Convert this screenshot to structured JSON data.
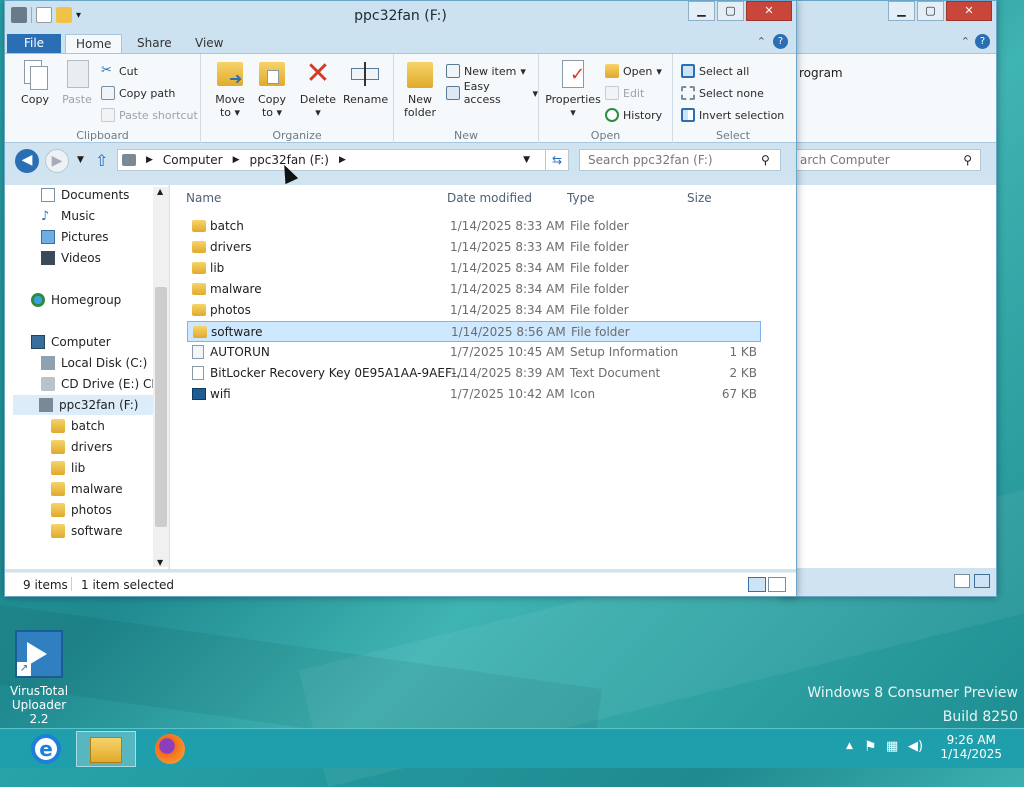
{
  "back_window": {
    "ribbon_partial": "rogram",
    "search_placeholder": "arch Computer"
  },
  "window": {
    "title": "ppc32fan (F:)",
    "tabs": [
      "File",
      "Home",
      "Share",
      "View"
    ],
    "ribbon": {
      "clipboard": {
        "label": "Clipboard",
        "copy": "Copy",
        "paste": "Paste",
        "cut": "Cut",
        "copy_path": "Copy path",
        "paste_shortcut": "Paste shortcut"
      },
      "organize": {
        "label": "Organize",
        "move_to": "Move to",
        "copy_to": "Copy to",
        "delete": "Delete",
        "rename": "Rename"
      },
      "new": {
        "label": "New",
        "new_folder": "New folder",
        "new_item": "New item",
        "easy_access": "Easy access"
      },
      "open": {
        "label": "Open",
        "properties": "Properties",
        "open": "Open",
        "edit": "Edit",
        "history": "History"
      },
      "select": {
        "label": "Select",
        "select_all": "Select all",
        "select_none": "Select none",
        "invert": "Invert selection"
      }
    },
    "address": {
      "crumbs": [
        "Computer",
        "ppc32fan (F:)"
      ],
      "search_placeholder": "Search ppc32fan (F:)"
    },
    "nav": {
      "libraries": [
        "Documents",
        "Music",
        "Pictures",
        "Videos"
      ],
      "homegroup": "Homegroup",
      "computer": "Computer",
      "drives": [
        "Local Disk (C:)",
        "CD Drive (E:) CDF",
        "ppc32fan (F:)"
      ],
      "folders": [
        "batch",
        "drivers",
        "lib",
        "malware",
        "photos",
        "software"
      ]
    },
    "columns": [
      "Name",
      "Date modified",
      "Type",
      "Size"
    ],
    "files": [
      {
        "name": "batch",
        "date": "1/14/2025 8:33 AM",
        "type": "File folder",
        "size": "",
        "kind": "folder"
      },
      {
        "name": "drivers",
        "date": "1/14/2025 8:33 AM",
        "type": "File folder",
        "size": "",
        "kind": "folder"
      },
      {
        "name": "lib",
        "date": "1/14/2025 8:34 AM",
        "type": "File folder",
        "size": "",
        "kind": "folder"
      },
      {
        "name": "malware",
        "date": "1/14/2025 8:34 AM",
        "type": "File folder",
        "size": "",
        "kind": "folder"
      },
      {
        "name": "photos",
        "date": "1/14/2025 8:34 AM",
        "type": "File folder",
        "size": "",
        "kind": "folder"
      },
      {
        "name": "software",
        "date": "1/14/2025 8:56 AM",
        "type": "File folder",
        "size": "",
        "kind": "folder",
        "selected": true
      },
      {
        "name": "AUTORUN",
        "date": "1/7/2025 10:45 AM",
        "type": "Setup Information",
        "size": "1 KB",
        "kind": "ini"
      },
      {
        "name": "BitLocker Recovery Key 0E95A1AA-9AEF-...",
        "date": "1/14/2025 8:39 AM",
        "type": "Text Document",
        "size": "2 KB",
        "kind": "txt"
      },
      {
        "name": "wifi",
        "date": "1/7/2025 10:42 AM",
        "type": "Icon",
        "size": "67 KB",
        "kind": "ico"
      }
    ],
    "status": {
      "items": "9 items",
      "selected": "1 item selected"
    }
  },
  "desktop": {
    "icon_label": "VirusTotal Uploader 2.2",
    "watermark_line1": "Windows 8 Consumer Preview",
    "watermark_line2": "Build 8250"
  },
  "taskbar": {
    "time": "9:26 AM",
    "date": "1/14/2025"
  }
}
